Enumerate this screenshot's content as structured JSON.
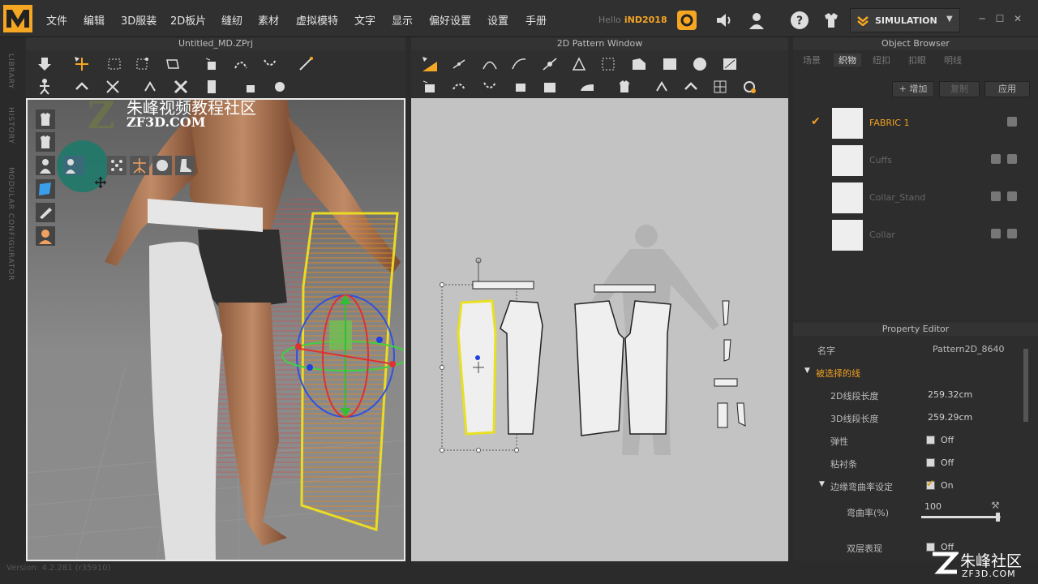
{
  "menu": {
    "items": [
      "文件",
      "编辑",
      "3D服装",
      "2D板片",
      "缝纫",
      "素材",
      "虚拟模特",
      "文字",
      "显示",
      "偏好设置",
      "设置",
      "手册"
    ],
    "hello_label": "Hello",
    "user": "iND2018",
    "mode": "SIMULATION"
  },
  "left_strip": {
    "labels": [
      "LIBRARY",
      "HISTORY",
      "MODULAR CONFIGURATOR"
    ]
  },
  "view3d": {
    "title": "Untitled_MD.ZPrj",
    "watermark_cn": "朱峰视频教程社区",
    "watermark_en": "ZF3D.COM"
  },
  "view2d": {
    "title": "2D Pattern Window"
  },
  "object_browser": {
    "title": "Object Browser",
    "tabs": [
      "场景",
      "织物",
      "纽扣",
      "扣眼",
      "明线"
    ],
    "active_tab": 1,
    "buttons": {
      "add": "+ 增加",
      "copy": "复制",
      "apply": "应用"
    },
    "fabrics": [
      {
        "name": "FABRIC 1",
        "selected": true
      },
      {
        "name": "Cuffs",
        "selected": false
      },
      {
        "name": "Collar_Stand",
        "selected": false
      },
      {
        "name": "Collar",
        "selected": false
      }
    ]
  },
  "property_editor": {
    "title": "Property Editor",
    "name_label": "名字",
    "name_value": "Pattern2D_8640",
    "section": "被选择的线",
    "rows": [
      {
        "key": "2D线段长度",
        "value": "259.32cm"
      },
      {
        "key": "3D线段长度",
        "value": "259.29cm"
      },
      {
        "key": "弹性",
        "value": "Off"
      },
      {
        "key": "粘衬条",
        "value": "Off"
      },
      {
        "key": "边缘弯曲率设定",
        "value": "On"
      },
      {
        "key": "弯曲率(%)",
        "value": "100"
      },
      {
        "key": "双层表现",
        "value": "Off"
      }
    ],
    "curvature_slider_fraction": 0.97
  },
  "status": {
    "version": "Version: 4.2.281 (r35910)"
  },
  "brand": {
    "text": "朱峰社区",
    "url": "ZF3D.COM"
  },
  "colors": {
    "accent": "#f5a623",
    "selection": "#f0a020",
    "view2d_bg": "#c3c3c3"
  }
}
